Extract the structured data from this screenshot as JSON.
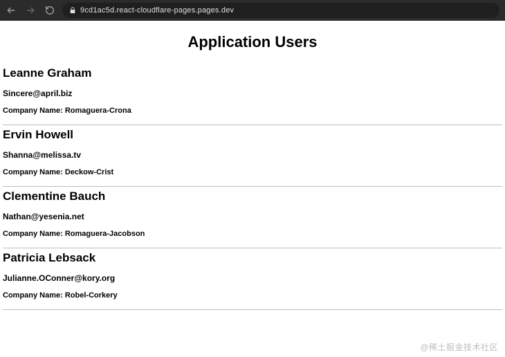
{
  "browser": {
    "url": "9cd1ac5d.react-cloudflare-pages.pages.dev"
  },
  "page": {
    "title": "Application Users"
  },
  "users": [
    {
      "name": "Leanne Graham",
      "email": "Sincere@april.biz",
      "company_label": "Company Name: Romaguera-Crona"
    },
    {
      "name": "Ervin Howell",
      "email": "Shanna@melissa.tv",
      "company_label": "Company Name: Deckow-Crist"
    },
    {
      "name": "Clementine Bauch",
      "email": "Nathan@yesenia.net",
      "company_label": "Company Name: Romaguera-Jacobson"
    },
    {
      "name": "Patricia Lebsack",
      "email": "Julianne.OConner@kory.org",
      "company_label": "Company Name: Robel-Corkery"
    }
  ],
  "watermark": "@稀土掘金技术社区"
}
